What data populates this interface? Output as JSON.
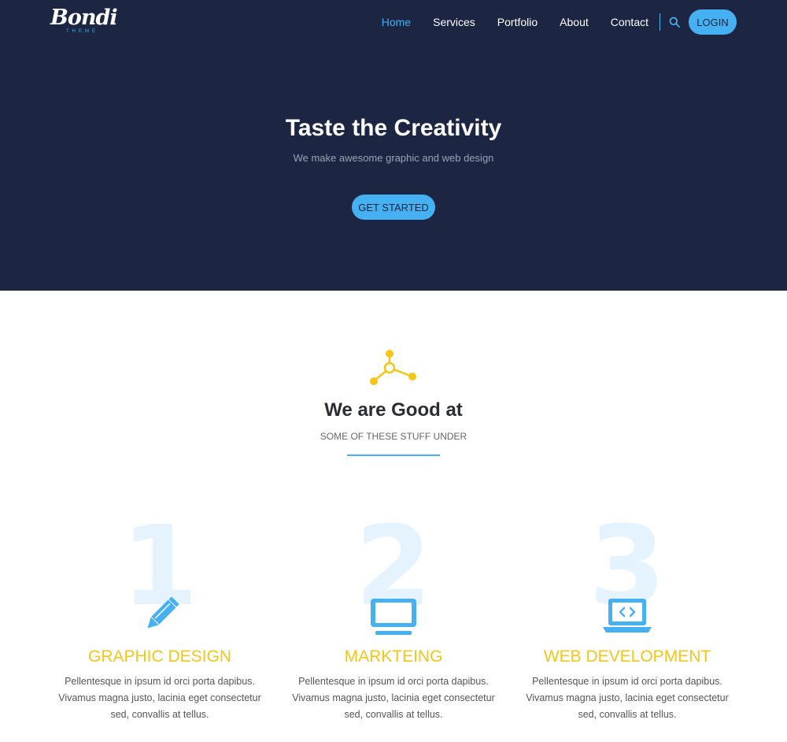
{
  "logo": {
    "script": "Bondi",
    "sub": "THEME"
  },
  "nav": {
    "items": [
      "Home",
      "Services",
      "Portfolio",
      "About",
      "Contact"
    ],
    "active": "Home",
    "search_icon": "search-icon",
    "login": "LOGIN"
  },
  "hero": {
    "title": "Taste the Creativity",
    "subtitle": "We make awesome graphic and web design",
    "cta": "GET STARTED"
  },
  "section": {
    "icon": "network-icon",
    "title": "We are Good at",
    "subtitle": "SOME OF THESE STUFF UNDER"
  },
  "cards": [
    {
      "number": "1",
      "icon": "pencil-icon",
      "title": "GRAPHIC DESIGN",
      "text": "Pellentesque in ipsum id orci porta dapibus. Vivamus magna justo, lacinia eget consectetur sed, convallis at tellus."
    },
    {
      "number": "2",
      "icon": "monitor-icon",
      "title": "MARKTEING",
      "text": "Pellentesque in ipsum id orci porta dapibus. Vivamus magna justo, lacinia eget consectetur sed, convallis at tellus."
    },
    {
      "number": "3",
      "icon": "laptop-code-icon",
      "title": "WEB DEVELOPMENT",
      "text": "Pellentesque in ipsum id orci porta dapibus. Vivamus magna justo, lacinia eget consectetur sed, convallis at tellus."
    }
  ],
  "colors": {
    "navy": "#1c2541",
    "accent_blue": "#46b1f2",
    "accent_yellow": "#f5c518"
  }
}
